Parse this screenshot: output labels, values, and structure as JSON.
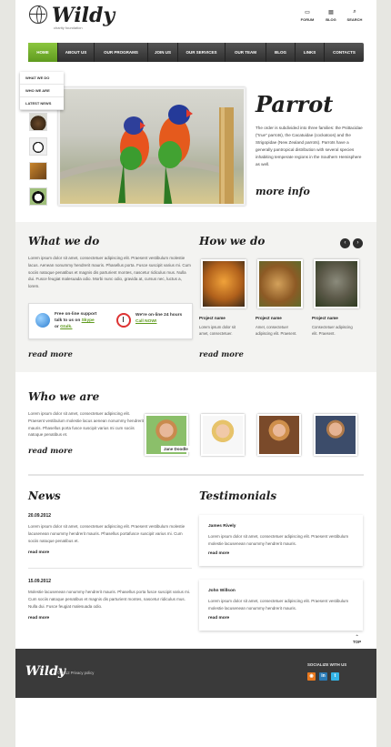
{
  "brand": {
    "name": "Wildy",
    "tagline": "charity foundation"
  },
  "header_links": [
    {
      "label": "FORUM",
      "icon": "chat-icon"
    },
    {
      "label": "BLOG",
      "icon": "blog-icon"
    },
    {
      "label": "SEARCH",
      "icon": "search-icon"
    }
  ],
  "nav": [
    "HOME",
    "ABOUT US",
    "OUR PROGRAMS",
    "JOIN US",
    "OUR SERVICES",
    "OUR TEAM",
    "BLOG",
    "LINKS",
    "CONTACTS"
  ],
  "dropdown": [
    "WHAT WE DO",
    "WHO WE ARE",
    "LATEST NEWS"
  ],
  "hero": {
    "title": "Parrot",
    "text": "The order is subdivided into three families: the Psittacidae (\"true\" parrots), the Cacatuidae (cockatoos) and the Strigopidae (New Zealand parrots). Parrots have a generally pantropical distribution with several species inhabiting temperate regions in the Southern Hemisphere as well.",
    "more": "more info"
  },
  "what_we_do": {
    "title": "What we do",
    "text": "Lorem ipsum dolor sit amet, consectetuer adipiscing elit. Praesent vestibulum molestie lacus. Aenean nonummy hendrerit mauris. Phasellus porta. Fusce suscipit varius mi. Cum sociis natoque penatibus et magnis dis parturient montes, nascetur ridiculus mus. Nulla dui. Fusce feugiat malesuada odio. Morbi nunc odio, gravida at, cursus nec, luctus a, lorem.",
    "support": {
      "line1": "Free on-line support",
      "line2": "talk to us on",
      "skype": "Skype",
      "or": "or",
      "gtalk": "Gtalk.",
      "hours_line1": "We're on-line 24 hours",
      "call": "Call NOW!"
    },
    "more": "read more"
  },
  "how_we_do": {
    "title": "How we do",
    "projects": [
      {
        "name": "Project name",
        "text": "Lorem ipsum dolor sit amet, consectetuer."
      },
      {
        "name": "Project name",
        "text": "Amet, consectetuer adipiscing elit. Praesent."
      },
      {
        "name": "Project name",
        "text": "Consectetuer adipiscing elit. Praesent."
      }
    ],
    "more": "read more"
  },
  "who_we_are": {
    "title": "Who we are",
    "text": "Lorem ipsum dolor sit amet, consectetuer adipiscing elit. Praesent vestibulum molestie lacus aenean nonummy hendrerit mauris. Phasellus porta fusce suscipit varius mi cum sociis natoque penatibus et.",
    "label": "Jane Doodle",
    "more": "read more"
  },
  "news": {
    "title": "News",
    "items": [
      {
        "date": "20.09.2012",
        "text": "Lorem ipsum dolor sit amet, consectetuer adipiscing elit. Praesent vestibulum molestie lacusenean nonummy hendrerit mauris. Phasellus portafusce suscipit varius mi. Cum sociis natoque penatibus et.",
        "more": "read more"
      },
      {
        "date": "15.09.2012",
        "text": "Molestie lacusenean nonummy hendrerit mauris. Phasellus porta fusce suscipit varius mi. Cum sociis natoque penatibus et magnis dis parturient montes, nascetur ridiculus mus. Nulla dui. Fusce feugiat malesuada odio.",
        "more": "read more"
      }
    ]
  },
  "testimonials": {
    "title": "Testimonials",
    "items": [
      {
        "name": "James Rively",
        "text": "Lorem ipsum dolor sit amet, consectetuer adipiscing elit. Praesent vestibulum molestie lacusenean nonummy hendrerit mauris.",
        "more": "read more"
      },
      {
        "name": "John Willson",
        "text": "Lorem ipsum dolor sit amet, consectetuer adipiscing elit. Praesent vestibulum molestie lacusenean nonummy hendrerit mauris.",
        "more": "read more"
      }
    ]
  },
  "top_label": "TOP",
  "footer": {
    "logo": "Wildy",
    "copyright": "© 2012 Privacy policy",
    "social_title": "SOCIALIZE WITH US",
    "social": [
      "rss-icon",
      "linkedin-icon",
      "twitter-icon"
    ]
  }
}
